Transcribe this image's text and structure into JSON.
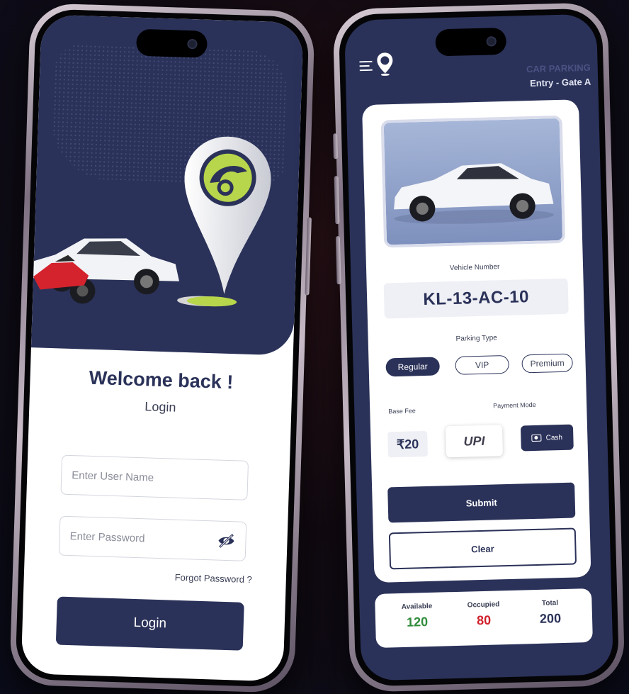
{
  "login_screen": {
    "welcome": "Welcome back !",
    "subtitle": "Login",
    "username_placeholder": "Enter User Name",
    "password_placeholder": "Enter Password",
    "forgot_password": "Forgot Password ?",
    "login_button": "Login"
  },
  "entry_screen": {
    "header": {
      "title": "CAR PARKING",
      "gate": "Entry - Gate A"
    },
    "vehicle_number_label": "Vehicle Number",
    "vehicle_number": "KL-13-AC-10",
    "parking_type_label": "Parking Type",
    "parking_types": [
      {
        "label": "Regular",
        "selected": true
      },
      {
        "label": "VIP",
        "selected": false
      },
      {
        "label": "Premium",
        "selected": false
      }
    ],
    "base_fee_label": "Base Fee",
    "base_fee": "₹20",
    "payment_mode_label": "Payment Mode",
    "payment_upi": "UPI",
    "payment_cash": "Cash",
    "submit_button": "Submit",
    "clear_button": "Clear",
    "stats": {
      "available_label": "Available",
      "available_value": "120",
      "occupied_label": "Occupied",
      "occupied_value": "80",
      "total_label": "Total",
      "total_value": "200"
    }
  },
  "colors": {
    "primary": "#2b3259",
    "accent_green": "#b8d64b",
    "available": "#2e8b3a",
    "occupied": "#d0202a",
    "total": "#2b3259"
  }
}
